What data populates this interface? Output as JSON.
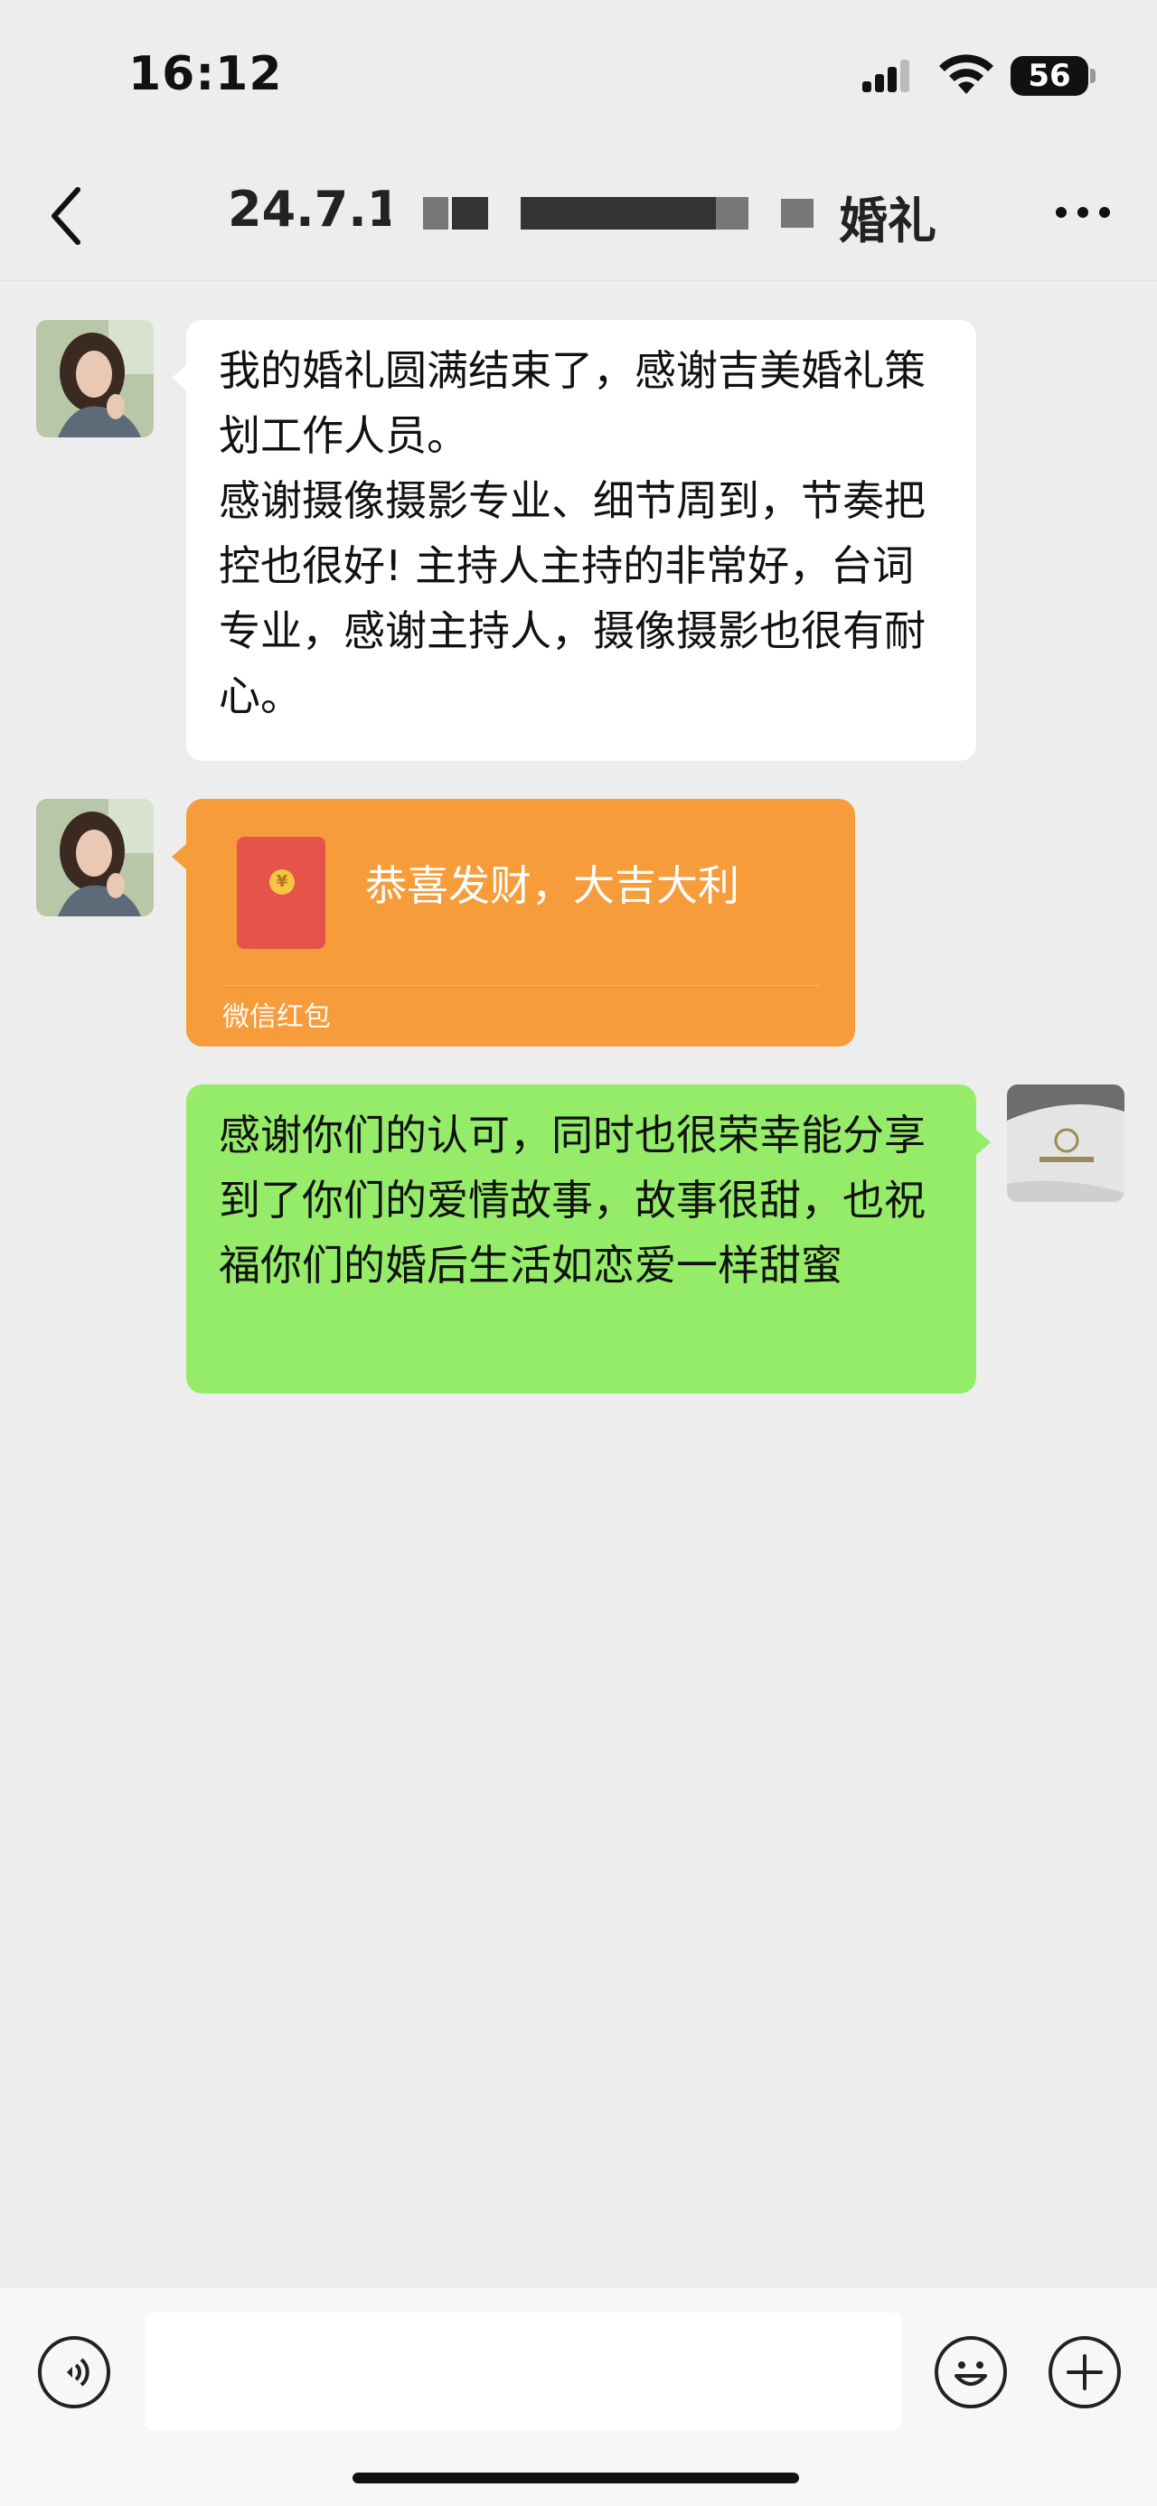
{
  "status_bar": {
    "time": "16:12",
    "battery": "56"
  },
  "header": {
    "title": "24.7.18",
    "title_suffix": "婚礼"
  },
  "messages": [
    {
      "side": "left",
      "text": "我的婚礼圆满结束了，感谢吉美婚礼策划工作人员。\n感谢摄像摄影专业、细节周到，节奏把控也很好! 主持人主持的非常好，台词专业，感谢主持人，摄像摄影也很有耐心。"
    },
    {
      "side": "left",
      "type": "red_packet",
      "text": "恭喜发财，大吉大利",
      "footer": "微信红包",
      "coin": "¥"
    },
    {
      "side": "right",
      "text": "感谢你们的认可，同时也很荣幸能分享到了你们的爱情故事，故事很甜，也祝福你们的婚后生活如恋爱一样甜蜜"
    }
  ],
  "input": {
    "placeholder": ""
  },
  "colors": {
    "green_bubble": "#95ec69",
    "red_packet": "#f79c3a",
    "background": "#ededed"
  }
}
